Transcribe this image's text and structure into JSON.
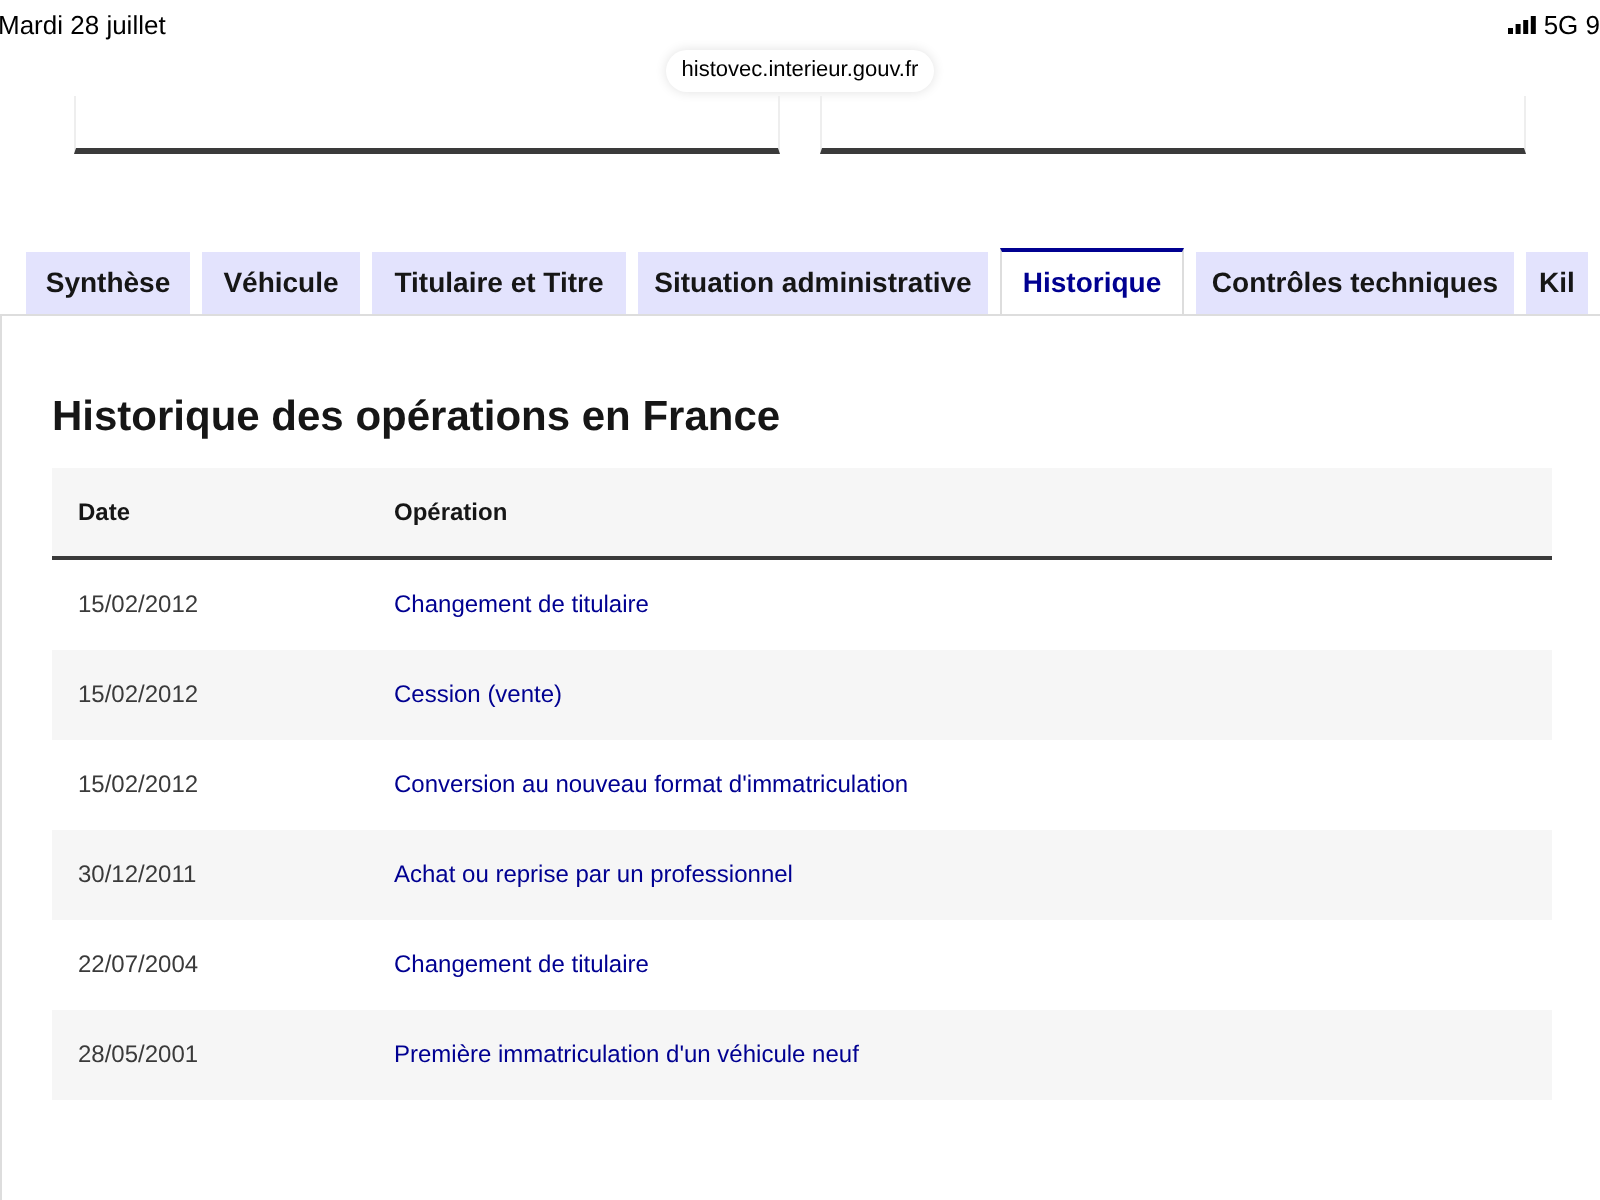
{
  "status_bar": {
    "date": "Mardi 28 juillet",
    "network": "5G 9"
  },
  "url_bar": {
    "address": "histovec.interieur.gouv.fr"
  },
  "tabs": [
    {
      "label": "Synthèse",
      "selected": false
    },
    {
      "label": "Véhicule",
      "selected": false
    },
    {
      "label": "Titulaire et Titre",
      "selected": false
    },
    {
      "label": "Situation administrative",
      "selected": false
    },
    {
      "label": "Historique",
      "selected": true
    },
    {
      "label": "Contrôles techniques",
      "selected": false
    },
    {
      "label": "Kil",
      "selected": false
    }
  ],
  "section": {
    "title": "Historique des opérations en France",
    "table": {
      "columns": [
        "Date",
        "Opération"
      ],
      "rows": [
        {
          "date": "15/02/2012",
          "operation": "Changement de titulaire"
        },
        {
          "date": "15/02/2012",
          "operation": "Cession (vente)"
        },
        {
          "date": "15/02/2012",
          "operation": "Conversion au nouveau format d'immatriculation"
        },
        {
          "date": "30/12/2011",
          "operation": "Achat ou reprise par un professionnel"
        },
        {
          "date": "22/07/2004",
          "operation": "Changement de titulaire"
        },
        {
          "date": "28/05/2001",
          "operation": "Première immatriculation d'un véhicule neuf"
        }
      ]
    }
  }
}
